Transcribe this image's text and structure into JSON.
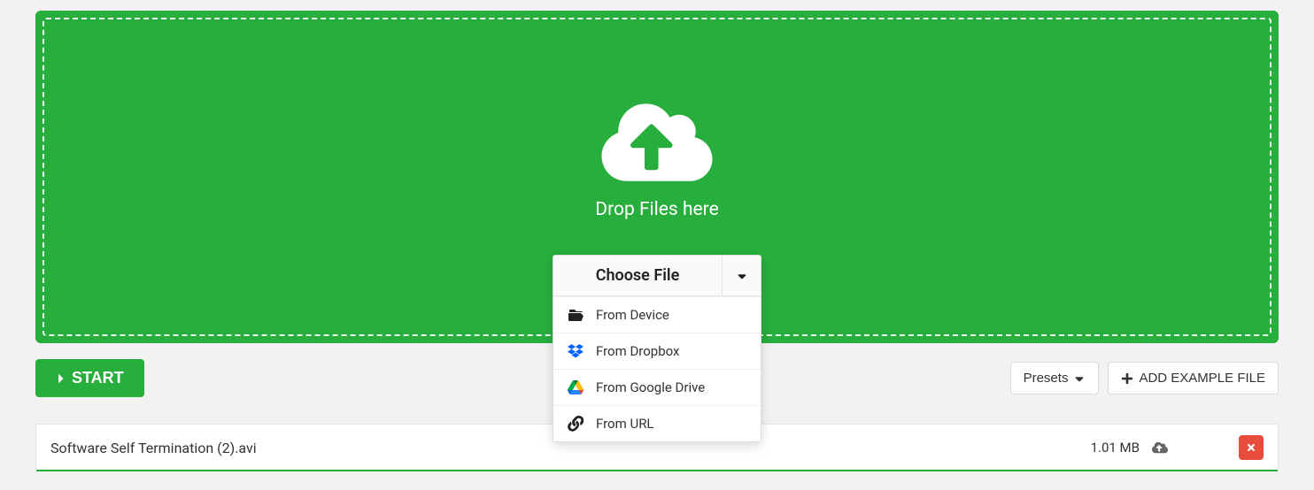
{
  "dropzone": {
    "label": "Drop Files here"
  },
  "choose_menu": {
    "title": "Choose File",
    "options": [
      {
        "label": "From Device",
        "icon": "folder-open-icon"
      },
      {
        "label": "From Dropbox",
        "icon": "dropbox-icon"
      },
      {
        "label": "From Google Drive",
        "icon": "google-drive-icon"
      },
      {
        "label": "From URL",
        "icon": "link-icon"
      }
    ]
  },
  "actions": {
    "start_label": "START",
    "presets_label": "Presets",
    "add_example_label": "ADD EXAMPLE FILE"
  },
  "file": {
    "name": "Software Self Termination (2).avi",
    "size": "1.01 MB"
  },
  "colors": {
    "primary_green": "#27ae3d",
    "danger_red": "#e74c3c"
  }
}
